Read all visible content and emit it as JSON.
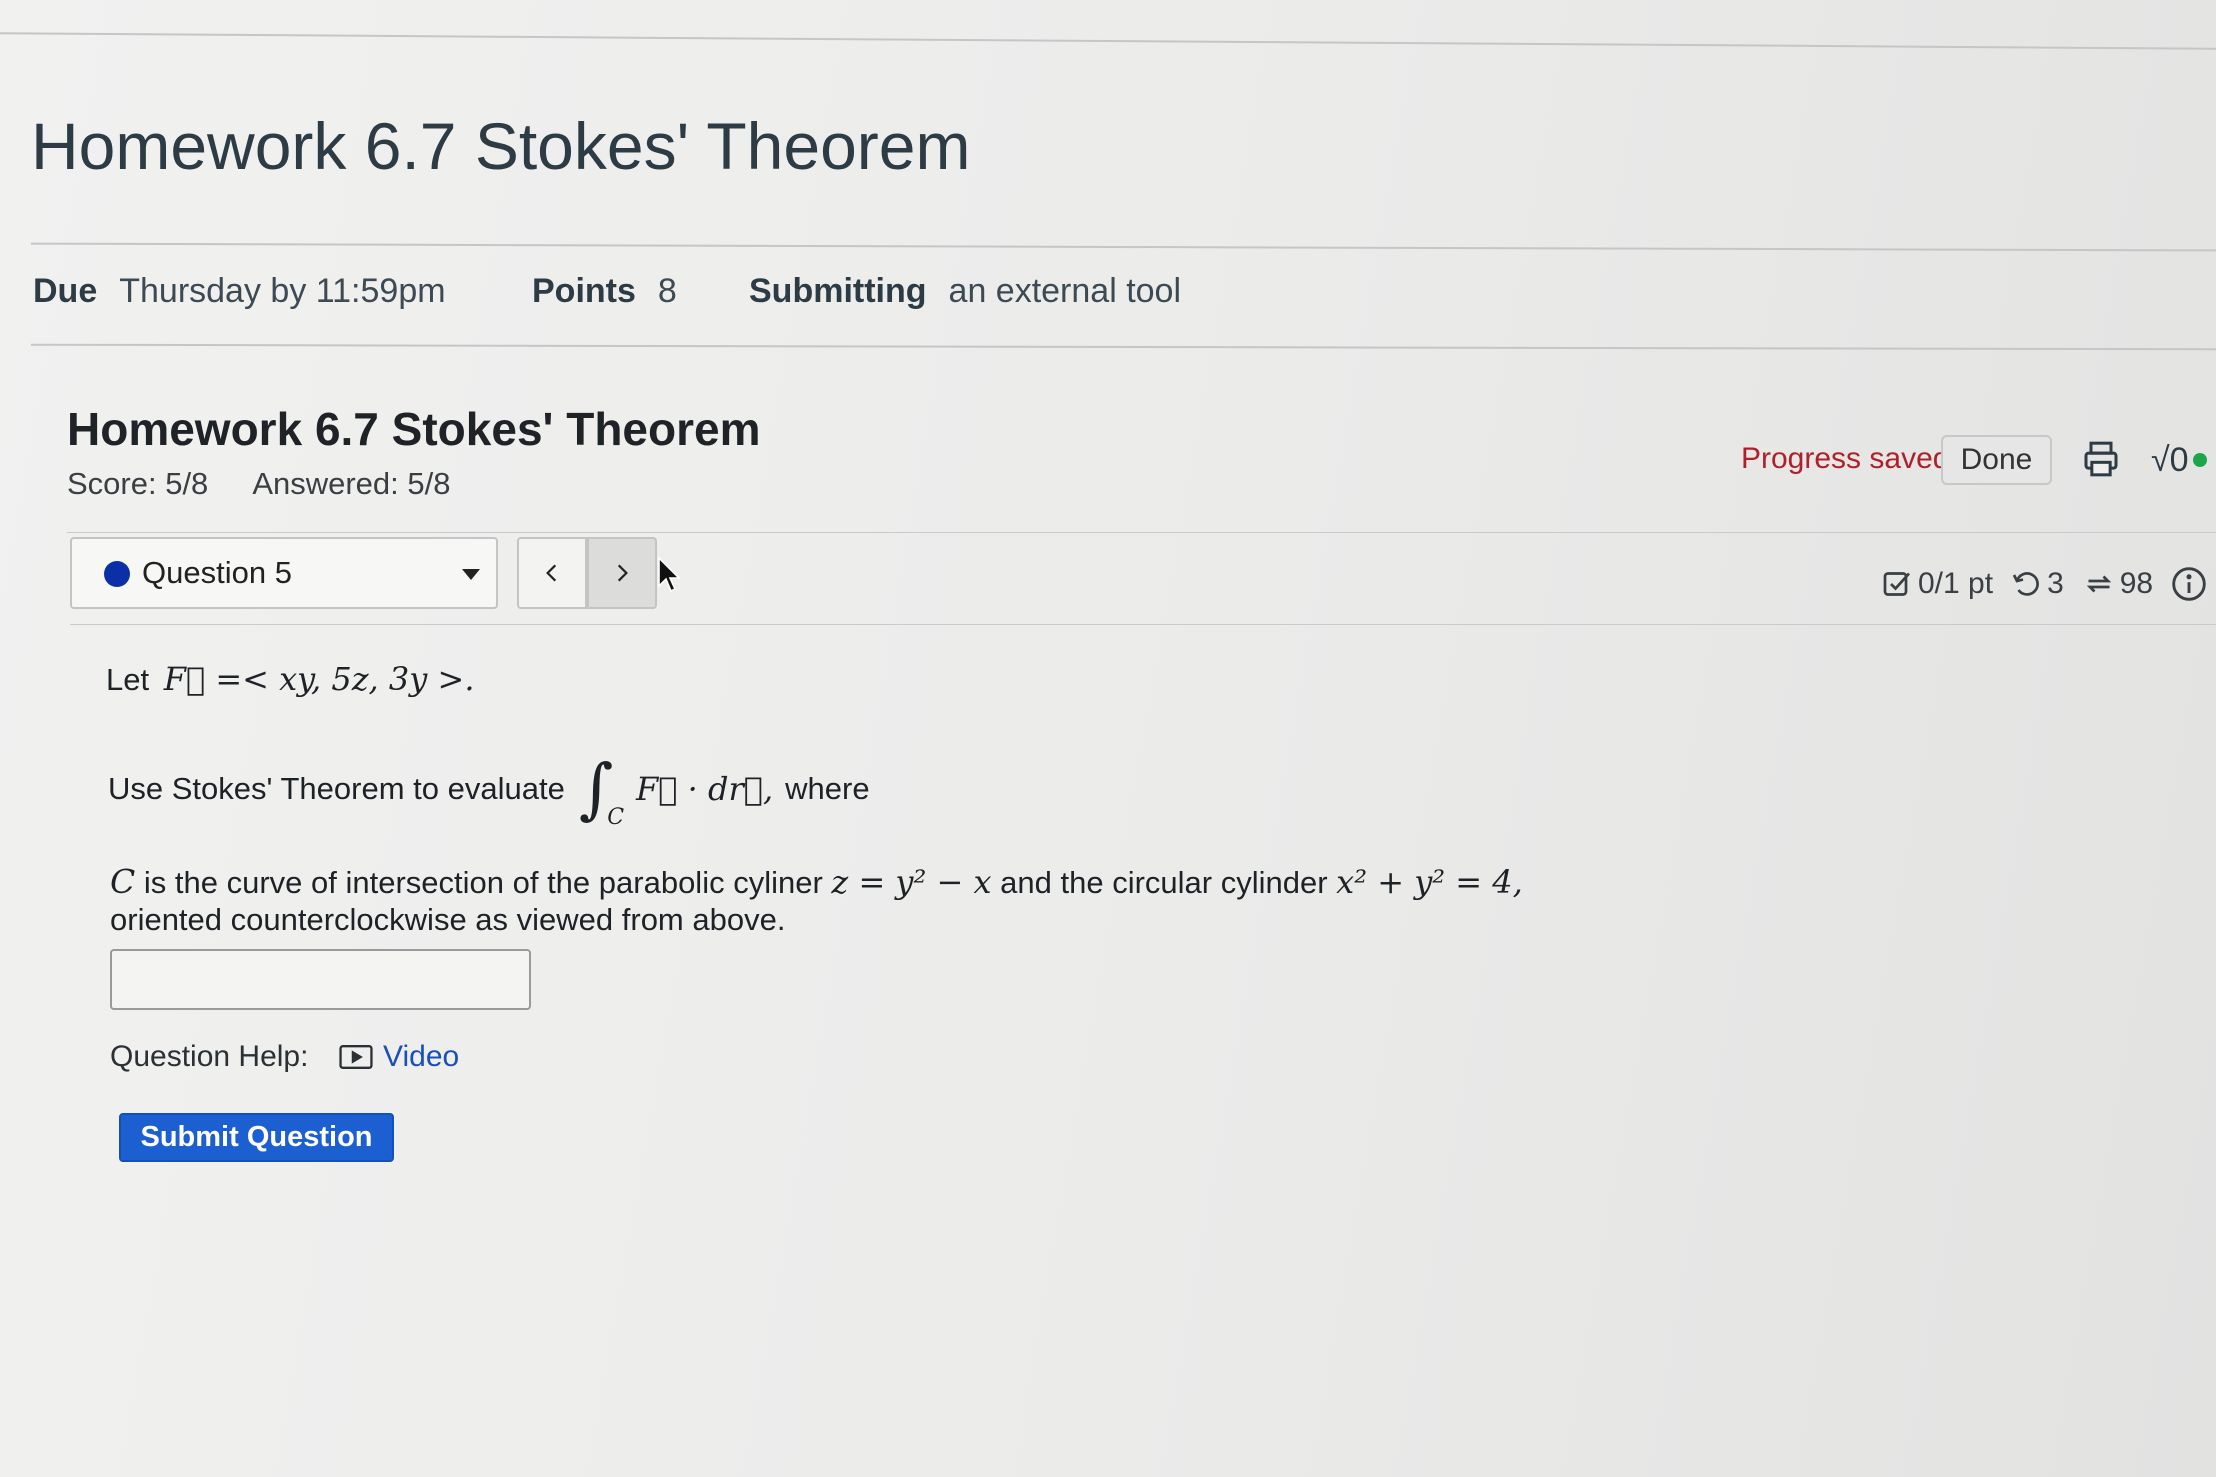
{
  "page": {
    "title": "Homework 6.7 Stokes' Theorem"
  },
  "meta": {
    "due_label": "Due",
    "due_value": "Thursday by 11:59pm",
    "points_label": "Points",
    "points_value": "8",
    "submitting_label": "Submitting",
    "submitting_value": "an external tool"
  },
  "assignment": {
    "title": "Homework 6.7 Stokes' Theorem",
    "score": "Score: 5/8",
    "answered": "Answered: 5/8",
    "progress_status": "Progress saved",
    "done_label": "Done",
    "print_icon": "print-icon",
    "math_icon": "sqrt-icon",
    "math_icon_text": "√0"
  },
  "question_nav": {
    "selected": "Question 5",
    "prev_icon": "chevron-left-icon",
    "next_icon": "chevron-right-icon"
  },
  "stats": {
    "points": "0/1 pt",
    "retries": "3",
    "attempts": "98"
  },
  "question": {
    "let_prefix": "Let",
    "field_def": "F⃗ =< xy, 5z, 3y >.",
    "instruction": "Use Stokes' Theorem to evaluate",
    "integral": "∫",
    "integral_sub": "C",
    "integrand": "F⃗ · dr⃗,",
    "where": "where",
    "curve_var": "C",
    "line1_a": "is the curve of intersection of the parabolic cyliner",
    "eq1": "z = y² − x",
    "line1_b": "and the circular cylinder",
    "eq2": "x² + y² = 4,",
    "line2": "oriented counterclockwise as viewed from above.",
    "answer_value": ""
  },
  "help": {
    "label": "Question Help:",
    "video_label": "Video",
    "video_icon": "video-icon"
  },
  "submit_label": "Submit Question",
  "colors": {
    "accent_blue": "#1b5fd1",
    "status_red": "#b0202a",
    "dot_blue": "#0b2fa6"
  }
}
